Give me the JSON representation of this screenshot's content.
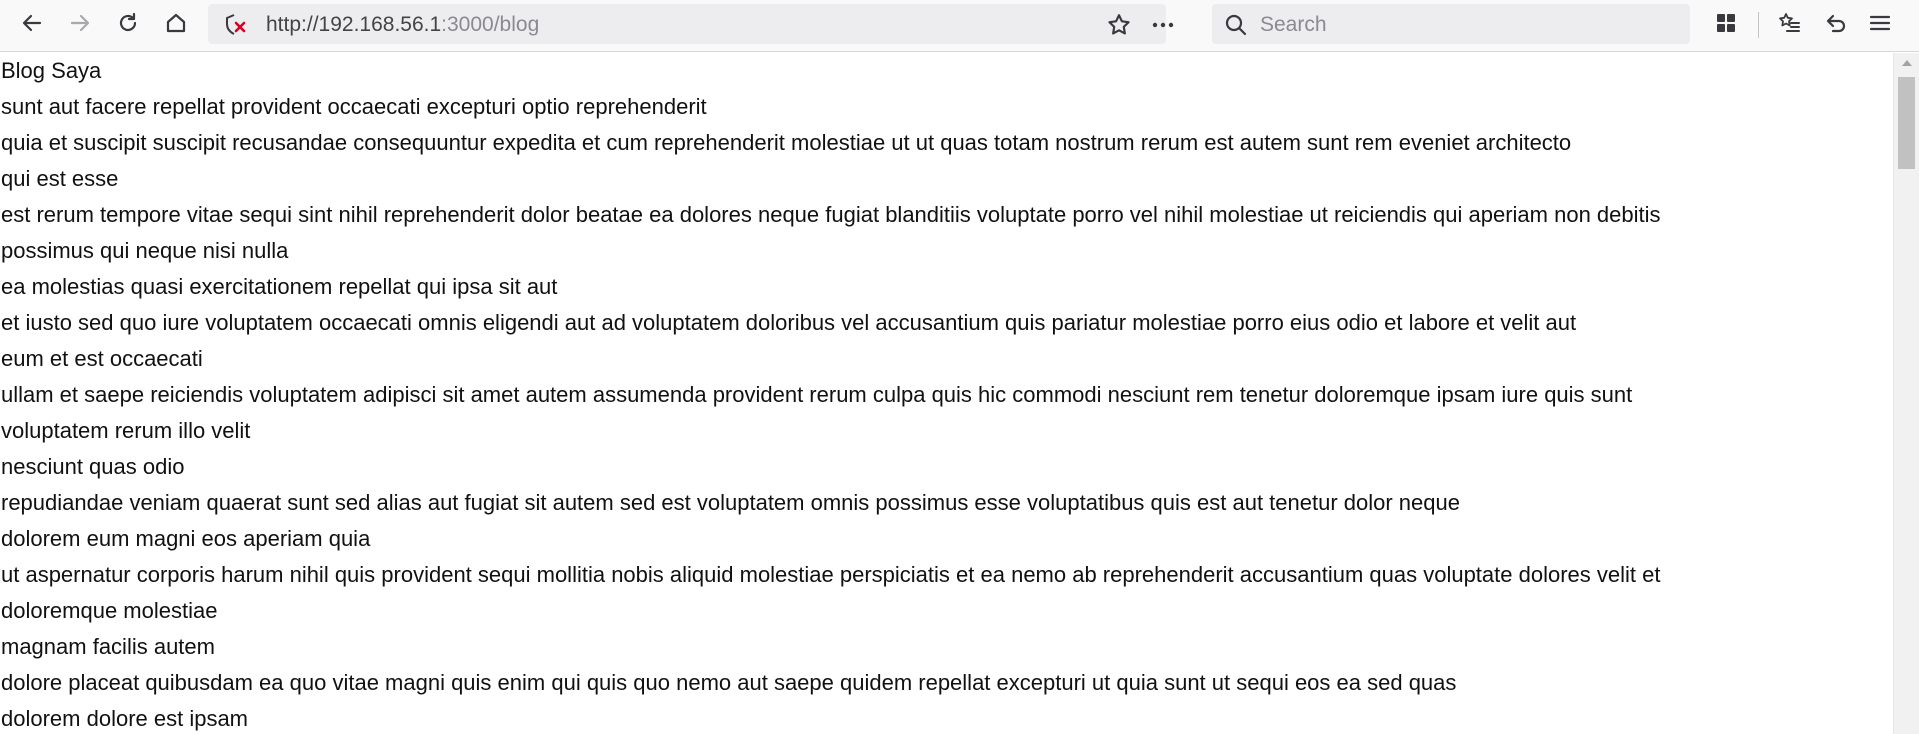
{
  "browser": {
    "url_host": "http://192.168.56.1",
    "url_rest": ":3000/blog",
    "search_placeholder": "Search",
    "icons": {
      "back": "back-arrow-icon",
      "forward": "forward-arrow-icon",
      "reload": "reload-icon",
      "home": "home-icon",
      "security": "insecure-connection-icon",
      "bookmark": "star-icon",
      "page_actions": "more-icon",
      "search": "search-icon",
      "library": "library-icon",
      "bookmarks_menu": "bookmarks-icon",
      "undo": "undo-icon",
      "menu": "hamburger-menu-icon"
    }
  },
  "page": {
    "title": "Blog Saya",
    "lines": [
      "sunt aut facere repellat provident occaecati excepturi optio reprehenderit",
      "quia et suscipit suscipit recusandae consequuntur expedita et cum reprehenderit molestiae ut ut quas totam nostrum rerum est autem sunt rem eveniet architecto",
      "qui est esse",
      "est rerum tempore vitae sequi sint nihil reprehenderit dolor beatae ea dolores neque fugiat blanditiis voluptate porro vel nihil molestiae ut reiciendis qui aperiam non debitis",
      "possimus qui neque nisi nulla",
      "ea molestias quasi exercitationem repellat qui ipsa sit aut",
      "et iusto sed quo iure voluptatem occaecati omnis eligendi aut ad voluptatem doloribus vel accusantium quis pariatur molestiae porro eius odio et labore et velit aut",
      "eum et est occaecati",
      "ullam et saepe reiciendis voluptatem adipisci sit amet autem assumenda provident rerum culpa quis hic commodi nesciunt rem tenetur doloremque ipsam iure quis sunt",
      "voluptatem rerum illo velit",
      "nesciunt quas odio",
      "repudiandae veniam quaerat sunt sed alias aut fugiat sit autem sed est voluptatem omnis possimus esse voluptatibus quis est aut tenetur dolor neque",
      "dolorem eum magni eos aperiam quia",
      "ut aspernatur corporis harum nihil quis provident sequi mollitia nobis aliquid molestiae perspiciatis et ea nemo ab reprehenderit accusantium quas voluptate dolores velit et",
      "doloremque molestiae",
      "magnam facilis autem",
      "dolore placeat quibusdam ea quo vitae magni quis enim qui quis quo nemo aut saepe quidem repellat excepturi ut quia sunt ut sequi eos ea sed quas",
      "dolorem dolore est ipsam"
    ]
  }
}
